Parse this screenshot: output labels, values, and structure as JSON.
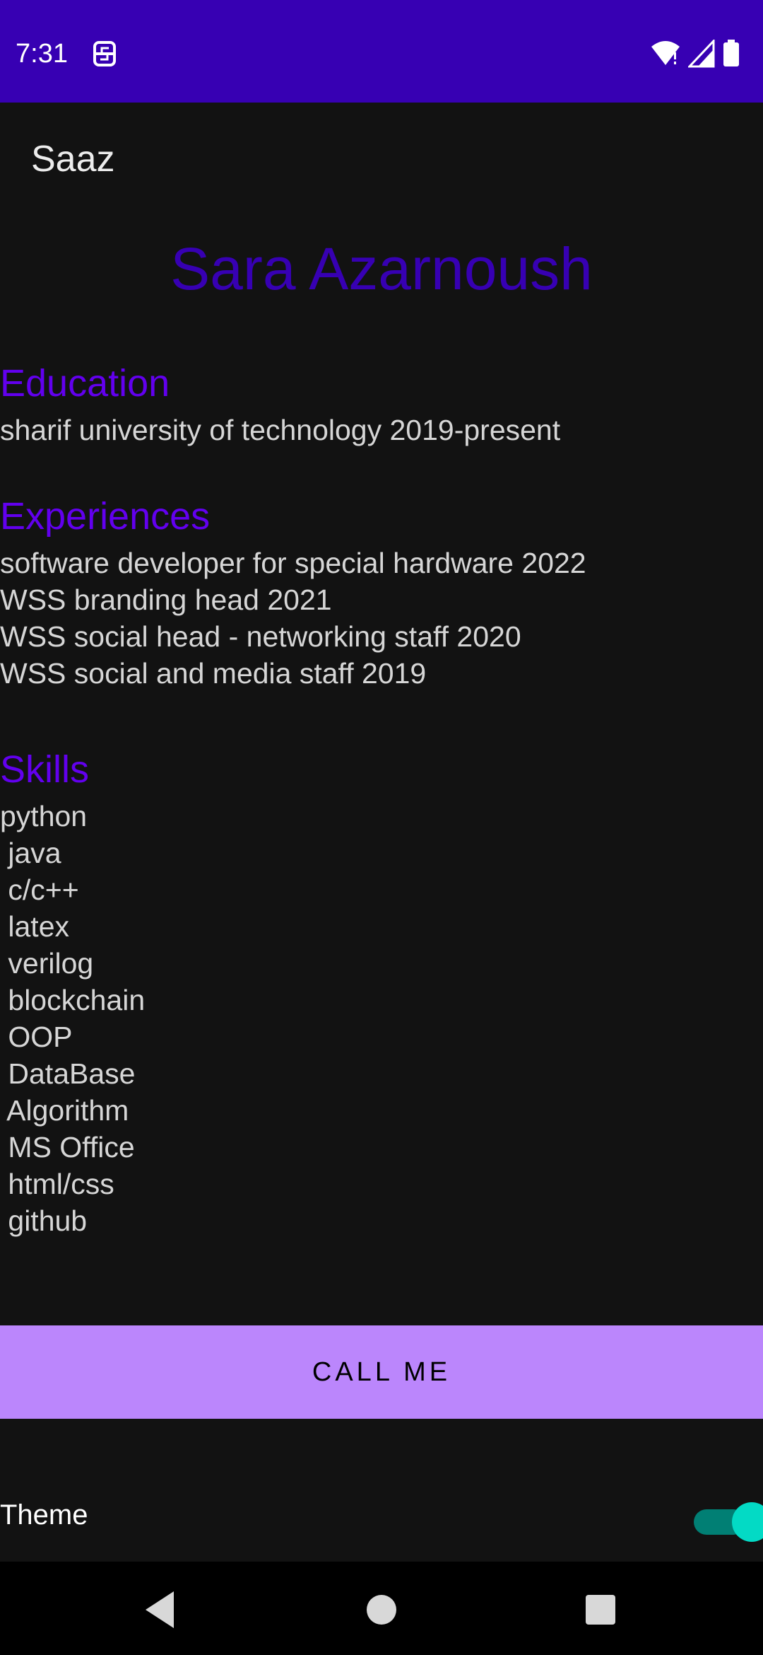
{
  "status_bar": {
    "time": "7:31",
    "icons": [
      "sim-icon",
      "wifi-icon",
      "signal-icon",
      "battery-icon"
    ]
  },
  "app_bar": {
    "title": "Saaz"
  },
  "profile": {
    "name": "Sara Azarnoush",
    "education": {
      "title": "Education",
      "items": [
        "sharif university of technology 2019-present"
      ]
    },
    "experiences": {
      "title": "Experiences",
      "items": [
        "software developer for special hardware 2022",
        "WSS branding head 2021",
        "WSS social head - networking staff 2020",
        "WSS social and media staff 2019"
      ]
    },
    "skills": {
      "title": "Skills",
      "items": [
        "python",
        " java",
        " c/c++",
        " latex",
        " verilog",
        " blockchain",
        " OOP",
        " DataBase",
        " Algorithm",
        " MS Office",
        " html/css",
        " github"
      ]
    }
  },
  "call_button": {
    "label": "CALL ME"
  },
  "theme": {
    "label": "Theme",
    "enabled": true
  },
  "colors": {
    "status_bar": "#3700B3",
    "name": "#3700B3",
    "section_title": "#6200EE",
    "button": "#BB86FC",
    "switch_thumb": "#03DAC5",
    "background": "#121212"
  },
  "nav_bar": {
    "icons": [
      "back-icon",
      "home-icon",
      "recents-icon"
    ]
  }
}
